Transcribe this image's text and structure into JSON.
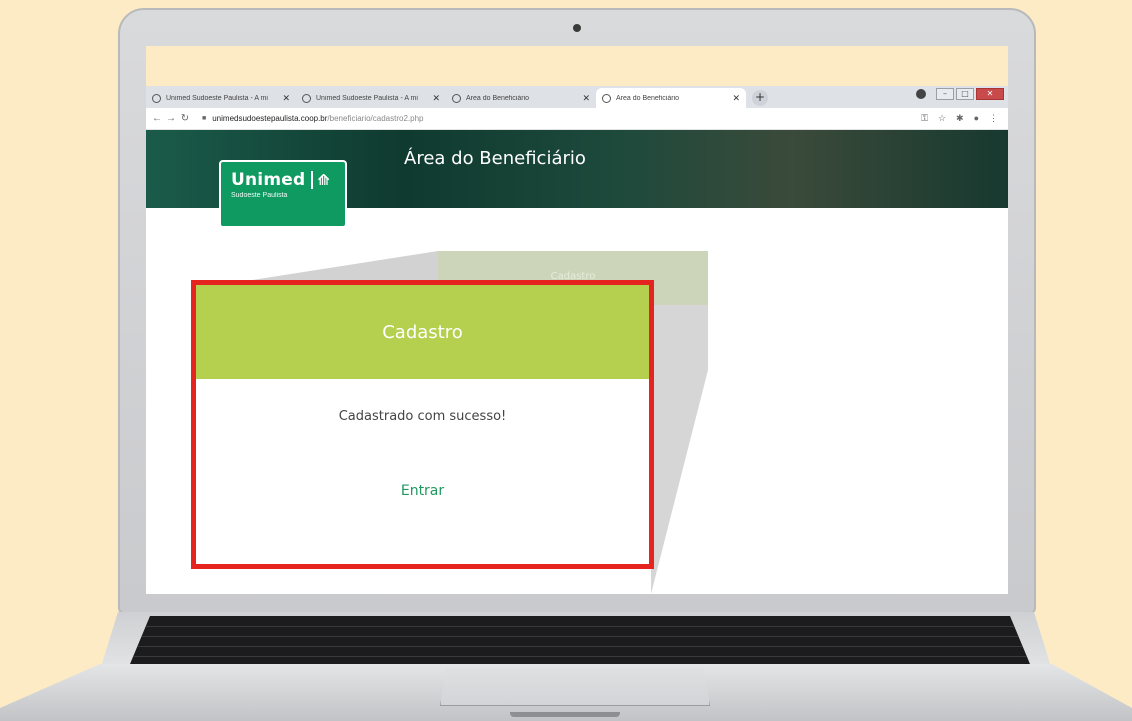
{
  "browser": {
    "tabs": [
      {
        "label": "Unimed Sudoeste Paulista - A mi",
        "active": false
      },
      {
        "label": "Unimed Sudoeste Paulista - A mi",
        "active": false
      },
      {
        "label": "Área do Beneficiário",
        "active": false
      },
      {
        "label": "Área do Beneficiário",
        "active": true
      }
    ],
    "new_tab": "+",
    "url_host": "unimedsudoestepaulista.coop.br",
    "url_path": "/beneficiario/cadastro2.php"
  },
  "page": {
    "title": "Área do Beneficiário",
    "logo_name": "Unimed",
    "logo_sub": "Sudoeste Paulista",
    "ghost_card_title": "Cadastro"
  },
  "modal": {
    "title": "Cadastro",
    "message": "Cadastrado com sucesso!",
    "action": "Entrar"
  },
  "colors": {
    "background": "#fcebc4",
    "header_green": "#b5d04e",
    "link_green": "#1f9960",
    "highlight_red": "#e52420",
    "brand_green": "#0f9a62"
  }
}
